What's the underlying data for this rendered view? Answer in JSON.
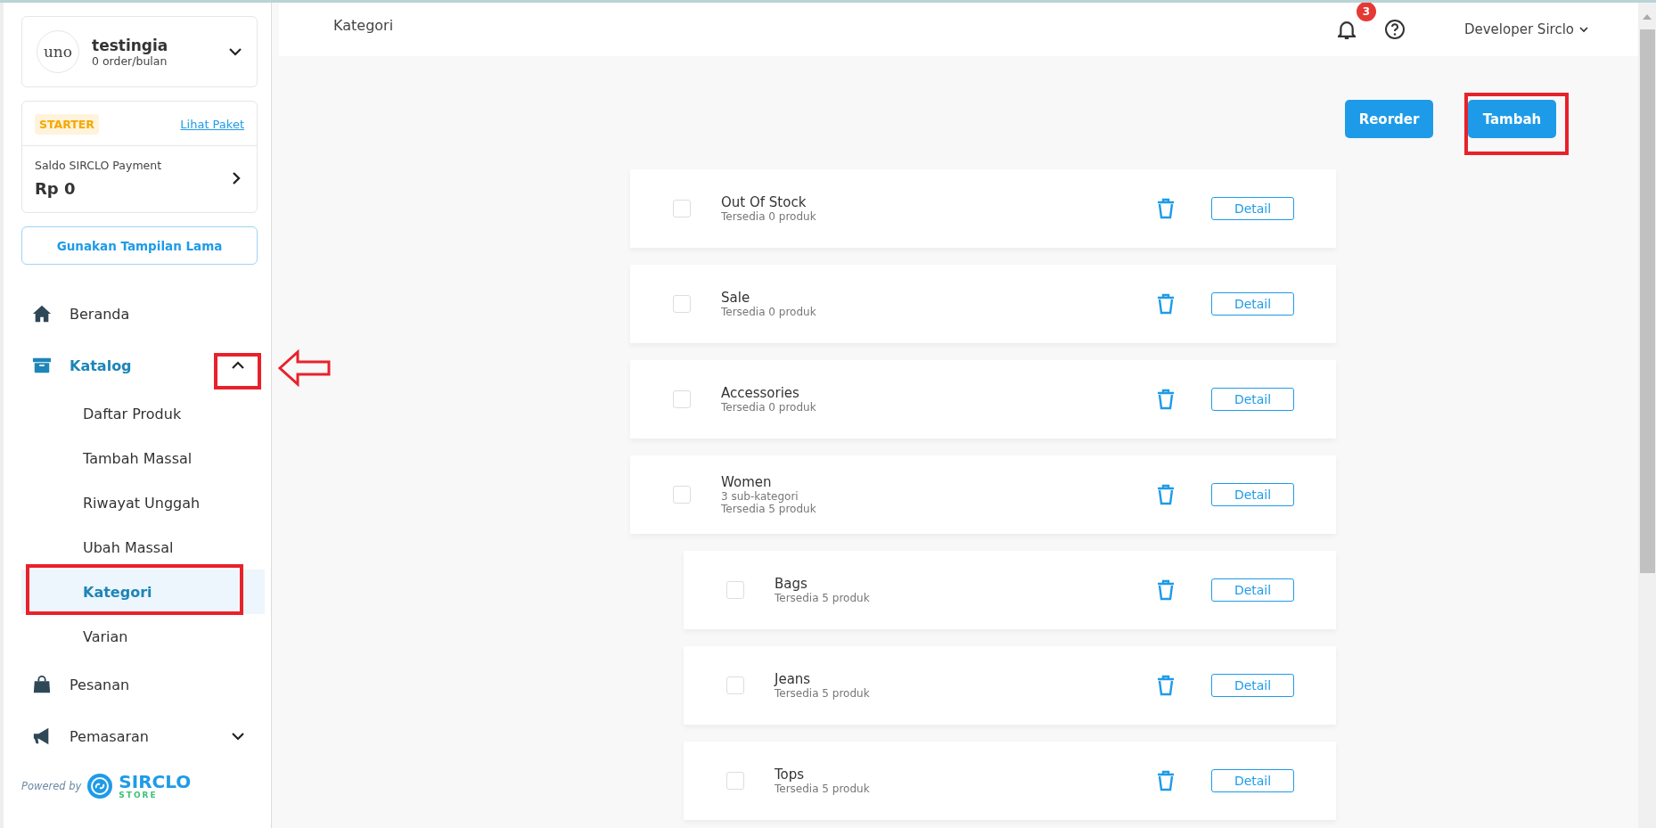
{
  "store": {
    "logo": "uno",
    "name": "testingia",
    "orders": "0 order/bulan"
  },
  "plan": {
    "badge": "STARTER",
    "link": "Lihat Paket",
    "balance_label": "Saldo SIRCLO Payment",
    "balance": "Rp 0"
  },
  "old_view_button": "Gunakan Tampilan Lama",
  "nav": [
    {
      "kind": "home",
      "label": "Beranda",
      "selected": false
    },
    {
      "kind": "catalog",
      "label": "Katalog",
      "selected": true,
      "expanded": true,
      "children": [
        {
          "label": "Daftar Produk",
          "selected": false
        },
        {
          "label": "Tambah Massal",
          "selected": false
        },
        {
          "label": "Riwayat Unggah",
          "selected": false
        },
        {
          "label": "Ubah Massal",
          "selected": false
        },
        {
          "label": "Kategori",
          "selected": true
        },
        {
          "label": "Varian",
          "selected": false
        }
      ]
    },
    {
      "kind": "orders",
      "label": "Pesanan",
      "selected": false
    },
    {
      "kind": "marketing",
      "label": "Pemasaran",
      "selected": false,
      "expanded": false
    }
  ],
  "powered_by": {
    "label": "Powered by",
    "brand": "SIRCLO",
    "sub": "STORE"
  },
  "header": {
    "title": "Kategori",
    "notifications": "3",
    "user": "Developer Sirclo"
  },
  "actions": [
    "Reorder",
    "Tambah"
  ],
  "categories": [
    {
      "name": "Out Of Stock",
      "lines": [
        "Tersedia 0 produk"
      ],
      "checked": false,
      "button": "Detail"
    },
    {
      "name": "Sale",
      "lines": [
        "Tersedia 0 produk"
      ],
      "checked": false,
      "button": "Detail"
    },
    {
      "name": "Accessories",
      "lines": [
        "Tersedia 0 produk"
      ],
      "checked": false,
      "button": "Detail"
    },
    {
      "name": "Women",
      "lines": [
        "3 sub-kategori",
        "Tersedia 5 produk"
      ],
      "checked": false,
      "button": "Detail",
      "children": [
        {
          "name": "Bags",
          "lines": [
            "Tersedia 5 produk"
          ],
          "checked": false,
          "button": "Detail"
        },
        {
          "name": "Jeans",
          "lines": [
            "Tersedia 5 produk"
          ],
          "checked": false,
          "button": "Detail"
        },
        {
          "name": "Tops",
          "lines": [
            "Tersedia 5 produk"
          ],
          "checked": false,
          "button": "Detail"
        }
      ]
    }
  ]
}
